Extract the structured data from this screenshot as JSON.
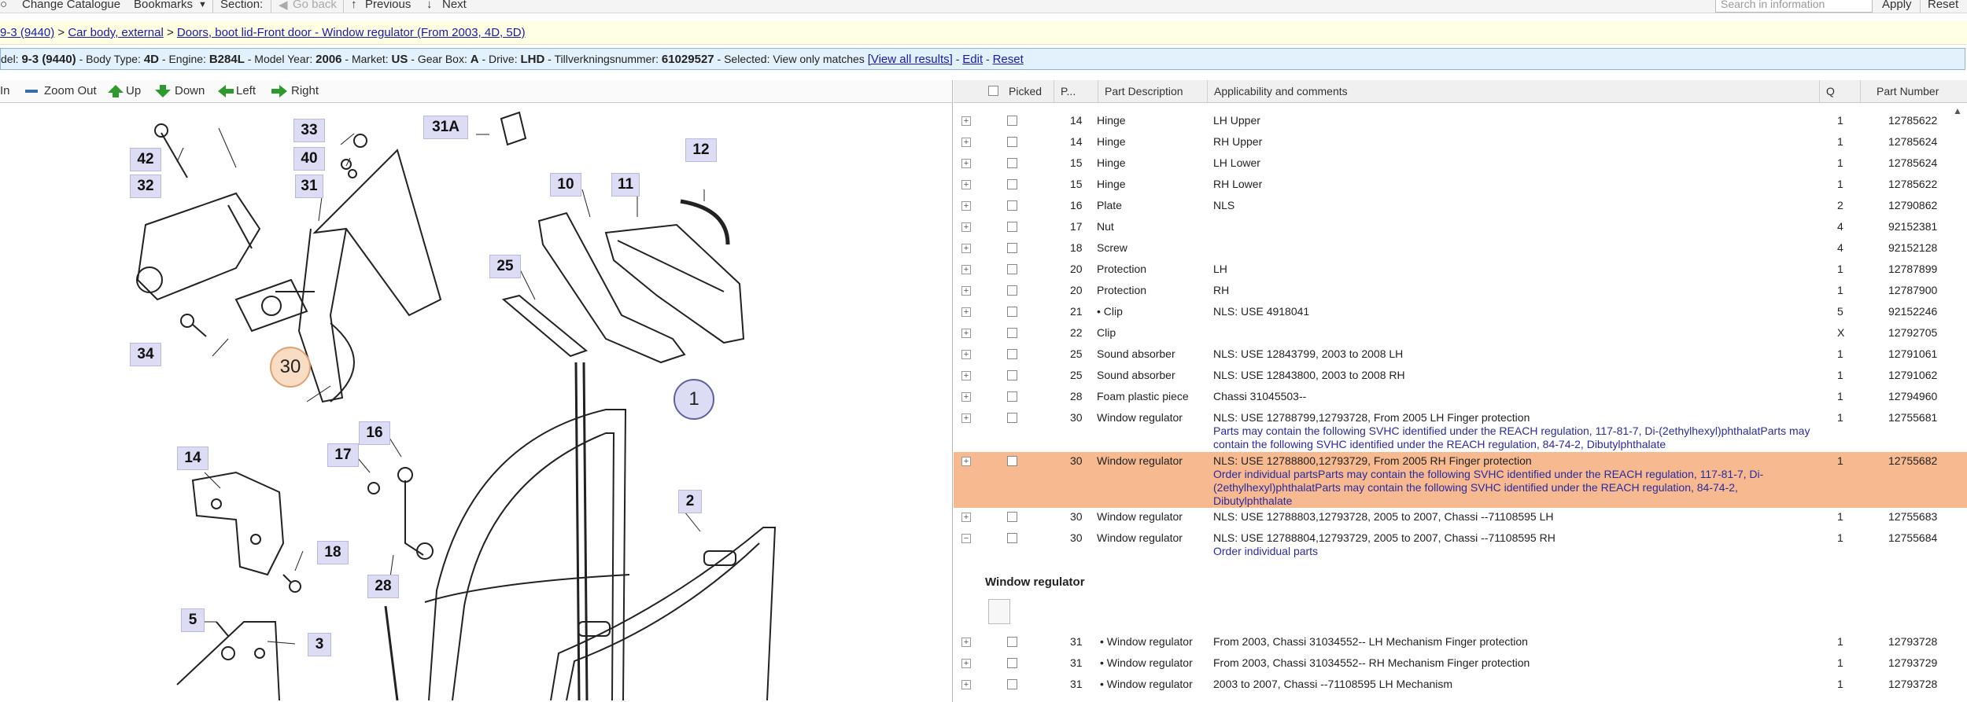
{
  "toolbar": {
    "change_catalogue": "Change Catalogue",
    "bookmarks": "Bookmarks",
    "section": "Section:",
    "go_back": "Go back",
    "previous": "Previous",
    "next": "Next",
    "search_placeholder": "Search in information",
    "apply": "Apply",
    "reset": "Reset"
  },
  "breadcrumb": {
    "model": "9-3 (9440)",
    "sep1": " > ",
    "group": "Car body, external",
    "sep2": " > ",
    "page": "Doors, boot lid-Front door - Window regulator (From 2003, 4D, 5D)"
  },
  "infobar": {
    "model_label": "del: ",
    "model": "9-3 (9440)",
    "body_label": " - Body Type: ",
    "body": "4D",
    "engine_label": " - Engine: ",
    "engine": "B284L",
    "year_label": " - Model Year: ",
    "year": "2006",
    "market_label": " - Market: ",
    "market": "US",
    "gearbox_label": " - Gear Box: ",
    "gearbox": "A",
    "drive_label": " - Drive: ",
    "drive": "LHD",
    "tillv_label": " - Tillverkningsnummer: ",
    "tillv": "61029527",
    "selected_label": " - Selected: ",
    "selected": "View only matches ",
    "view_all": "[View all results]",
    "edit": "Edit",
    "reset": "Reset",
    "dash": " - "
  },
  "zoom": {
    "zoom_in": "In",
    "zoom_out": "Zoom Out",
    "up": "Up",
    "down": "Down",
    "left": "Left",
    "right": "Right"
  },
  "diagram": {
    "callouts": [
      "42",
      "32",
      "33",
      "40",
      "31",
      "31A",
      "34",
      "10",
      "11",
      "12",
      "25",
      "17",
      "16",
      "14",
      "18",
      "28",
      "5",
      "3",
      "2"
    ],
    "circle_30": "30",
    "circle_1": "1"
  },
  "table": {
    "headers": {
      "picked": "Picked",
      "pos": "P...",
      "part_description": "Part Description",
      "applicability": "Applicability and comments",
      "q": "Q",
      "part_number": "Part Number"
    },
    "rows": [
      {
        "pos": "14",
        "desc": "Hinge",
        "app": "LH Upper",
        "note": "",
        "q": "1",
        "pn": "12785622"
      },
      {
        "pos": "14",
        "desc": "Hinge",
        "app": "RH Upper",
        "note": "",
        "q": "1",
        "pn": "12785624"
      },
      {
        "pos": "15",
        "desc": "Hinge",
        "app": "LH Lower",
        "note": "",
        "q": "1",
        "pn": "12785624"
      },
      {
        "pos": "15",
        "desc": "Hinge",
        "app": "RH Lower",
        "note": "",
        "q": "1",
        "pn": "12785622"
      },
      {
        "pos": "16",
        "desc": "Plate",
        "app": "NLS",
        "note": "",
        "q": "2",
        "pn": "12790862"
      },
      {
        "pos": "17",
        "desc": "Nut",
        "app": "",
        "note": "",
        "q": "4",
        "pn": "92152381"
      },
      {
        "pos": "18",
        "desc": "Screw",
        "app": "",
        "note": "",
        "q": "4",
        "pn": "92152128"
      },
      {
        "pos": "20",
        "desc": "Protection",
        "app": "LH",
        "note": "",
        "q": "1",
        "pn": "12787899"
      },
      {
        "pos": "20",
        "desc": "Protection",
        "app": "RH",
        "note": "",
        "q": "1",
        "pn": "12787900"
      },
      {
        "pos": "21",
        "desc": "• Clip",
        "app": "NLS: USE 4918041",
        "note": "",
        "q": "5",
        "pn": "92152246"
      },
      {
        "pos": "22",
        "desc": "Clip",
        "app": "",
        "note": "",
        "q": "X",
        "pn": "12792705"
      },
      {
        "pos": "25",
        "desc": "Sound absorber",
        "app": "NLS: USE 12843799, 2003 to 2008 LH",
        "note": "",
        "q": "1",
        "pn": "12791061"
      },
      {
        "pos": "25",
        "desc": "Sound absorber",
        "app": "NLS: USE 12843800, 2003 to 2008 RH",
        "note": "",
        "q": "1",
        "pn": "12791062"
      },
      {
        "pos": "28",
        "desc": "Foam plastic piece",
        "app": "Chassi 31045503--",
        "note": "",
        "q": "1",
        "pn": "12794960"
      },
      {
        "pos": "30",
        "desc": "Window regulator",
        "app": "NLS: USE 12788799,12793728, From 2005 LH Finger protection",
        "note": "Parts may contain the following SVHC identified under the REACH regulation, 117-81-7, Di-(2ethylhexyl)phthalatParts may contain the following SVHC identified under the REACH regulation, 84-74-2, Dibutylphthalate",
        "q": "1",
        "pn": "12755681"
      },
      {
        "pos": "30",
        "desc": "Window regulator",
        "app": "NLS: USE 12788800,12793729, From 2005 RH Finger protection",
        "note": "Order individual partsParts may contain the following SVHC identified under the REACH regulation, 117-81-7, Di-(2ethylhexyl)phthalatParts may contain the following SVHC identified under the REACH regulation, 84-74-2, Dibutylphthalate",
        "q": "1",
        "pn": "12755682"
      },
      {
        "pos": "30",
        "desc": "Window regulator",
        "app": "NLS: USE 12788803,12793728, 2005 to 2007, Chassi --71108595 LH",
        "note": "",
        "q": "1",
        "pn": "12755683"
      },
      {
        "pos": "30",
        "desc": "Window regulator",
        "app": "NLS: USE 12788804,12793729, 2005 to 2007, Chassi --71108595 RH",
        "note": "Order individual parts",
        "q": "1",
        "pn": "12755684"
      }
    ],
    "subsection_title": "Window regulator",
    "sub_rows": [
      {
        "pos": "31",
        "desc": "• Window regulator",
        "app": "From 2003, Chassi 31034552-- LH Mechanism Finger protection",
        "q": "1",
        "pn": "12793728"
      },
      {
        "pos": "31",
        "desc": "• Window regulator",
        "app": "From 2003, Chassi 31034552-- RH Mechanism Finger protection",
        "q": "1",
        "pn": "12793729"
      },
      {
        "pos": "31",
        "desc": "• Window regulator",
        "app": "2003 to 2007, Chassi --71108595 LH Mechanism",
        "q": "1",
        "pn": "12793728"
      }
    ]
  }
}
